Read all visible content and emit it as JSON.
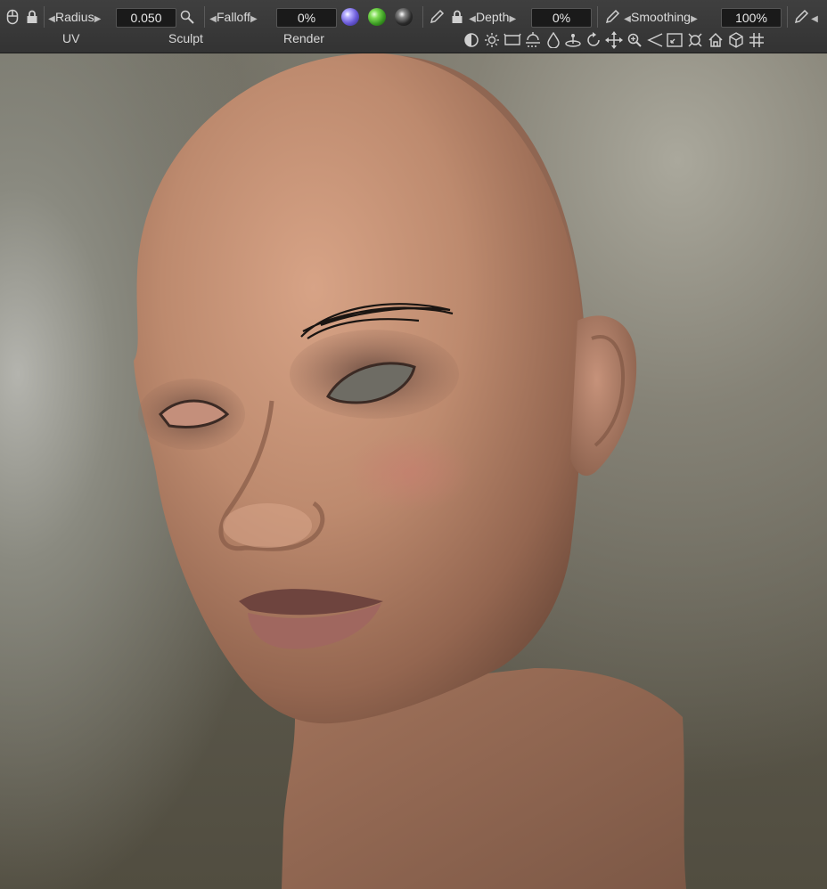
{
  "toolbar": {
    "radius_label": "Radius",
    "radius_value": "0.050",
    "falloff_label": "Falloff",
    "falloff_value": "0%",
    "depth_label": "Depth",
    "depth_value": "0%",
    "smoothing_label": "Smoothing",
    "smoothing_value": "100%"
  },
  "tabs": {
    "uv": "UV",
    "sculpt": "Sculpt",
    "render": "Render"
  },
  "nav_icons": [
    "half-circle-icon",
    "sun-icon",
    "frame-icon",
    "light-icon",
    "drop-icon",
    "pivot-icon",
    "rotate-icon",
    "move-icon",
    "zoom-icon",
    "perspective-icon",
    "fit-icon",
    "camera-icon",
    "home-icon",
    "cube-icon",
    "grid-icon"
  ],
  "colors": {
    "toolbar_bg": "#393939",
    "field_bg": "#1a1a1a",
    "material_purple": "#7b6ee0",
    "material_green": "#4fb83a",
    "skin": "#c69274"
  }
}
